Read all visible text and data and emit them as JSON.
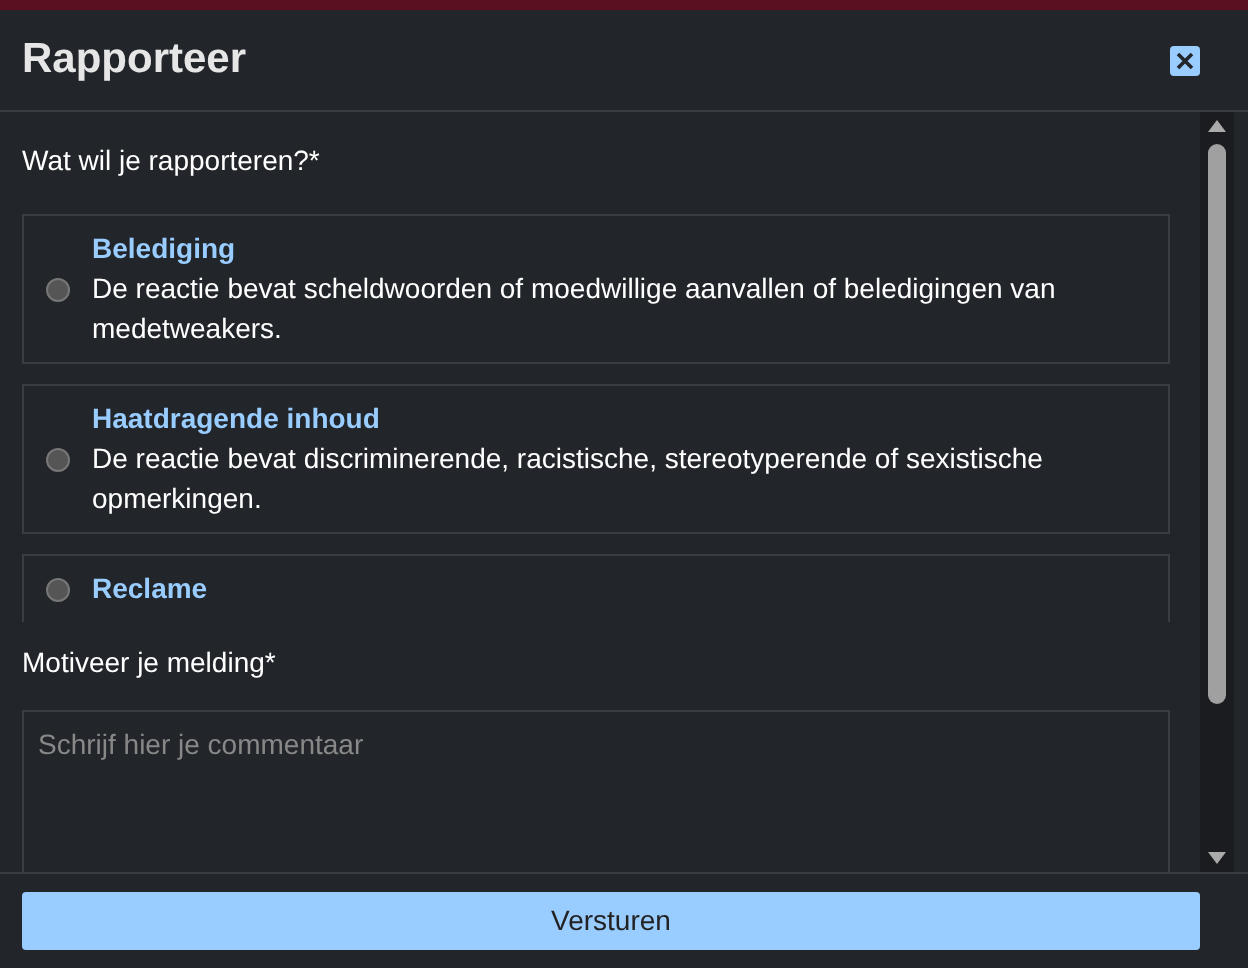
{
  "dialog": {
    "title": "Rapporteer"
  },
  "question": "Wat wil je rapporteren?*",
  "options": [
    {
      "title": "Belediging",
      "description": "De reactie bevat scheldwoorden of moedwillige aanvallen of beledigingen van medetweakers.",
      "selected": false
    },
    {
      "title": "Haatdragende inhoud",
      "description": "De reactie bevat discriminerende, racistische, stereotyperende of sexistische opmerkingen.",
      "selected": false
    },
    {
      "title": "Reclame",
      "selected": false
    }
  ],
  "comment": {
    "label": "Motiveer je melding*",
    "placeholder": "Schrijf hier je commentaar"
  },
  "submit": "Versturen"
}
